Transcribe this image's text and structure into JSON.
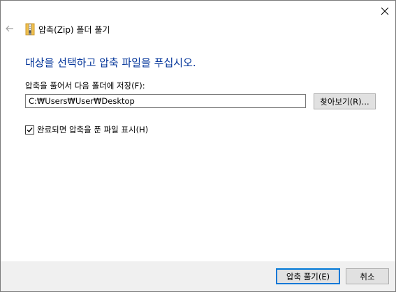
{
  "wizard": {
    "title": "압축(Zip) 폴더 풀기",
    "heading": "대상을 선택하고 압축 파일을 푸십시오.",
    "dest_label": "압축을 풀어서 다음 폴더에 저장(F):",
    "path_value": "C:₩Users₩User₩Desktop",
    "browse_label": "찾아보기(R)...",
    "show_files_label": "완료되면 압축을 푼 파일 표시(H)",
    "show_files_checked": true
  },
  "footer": {
    "extract_label": "압축 풀기(E)",
    "cancel_label": "취소"
  },
  "icons": {
    "close": "close-icon",
    "back": "back-arrow-icon",
    "zip": "zip-folder-icon"
  },
  "colors": {
    "heading": "#003399",
    "accent": "#0078d7",
    "footer_bg": "#f0f0f0"
  }
}
